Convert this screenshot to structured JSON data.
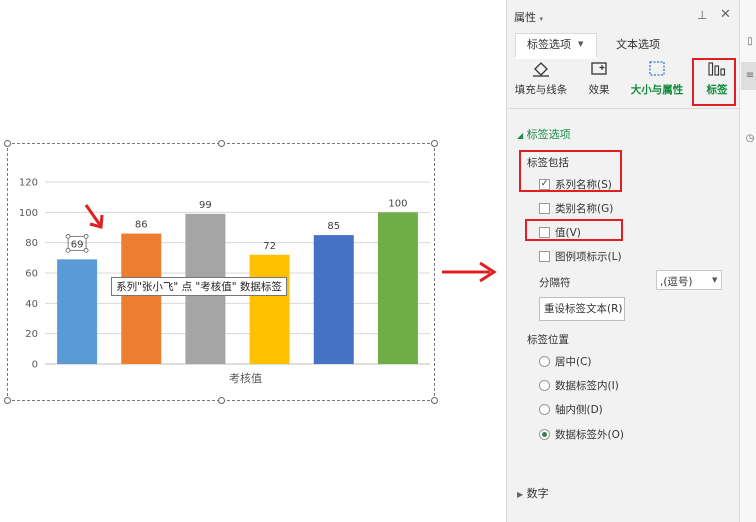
{
  "chart_data": {
    "type": "bar",
    "categories": [
      "",
      "",
      "",
      "",
      "",
      ""
    ],
    "series": [
      {
        "values": [
          69,
          86,
          99,
          72,
          85,
          100
        ]
      }
    ],
    "xlabel": "考核值",
    "ylim": [
      0,
      120
    ],
    "yticks": [
      "0",
      "20",
      "40",
      "60",
      "80",
      "100",
      "120"
    ],
    "data_labels": [
      "69",
      "86",
      "99",
      "72",
      "85",
      "100"
    ],
    "colors": [
      "#5b9bd5",
      "#ed7d31",
      "#a5a5a5",
      "#ffc000",
      "#4472c4",
      "#70ad47"
    ],
    "grid": true
  },
  "tooltip": "系列\"张小飞\" 点 \"考核值\" 数据标签",
  "panel": {
    "title": "属性",
    "tabs": [
      "标签选项",
      "文本选项"
    ],
    "tools": [
      "填充与线条",
      "效果",
      "大小与属性",
      "标签"
    ],
    "section_title": "标签选项",
    "contains_label": "标签包括",
    "checkboxes": [
      {
        "label": "系列名称(S)",
        "checked": true
      },
      {
        "label": "类别名称(G)",
        "checked": false
      },
      {
        "label": "值(V)",
        "checked": false
      },
      {
        "label": "图例项标示(L)",
        "checked": false
      }
    ],
    "separator_label": "分隔符",
    "separator_value": ",(逗号)",
    "reset_button": "重设标签文本(R)",
    "position_label": "标签位置",
    "radios": [
      {
        "label": "居中(C)",
        "selected": false
      },
      {
        "label": "数据标签内(I)",
        "selected": false
      },
      {
        "label": "轴内侧(D)",
        "selected": false
      },
      {
        "label": "数据标签外(O)",
        "selected": true
      }
    ],
    "number_section": "数字"
  }
}
